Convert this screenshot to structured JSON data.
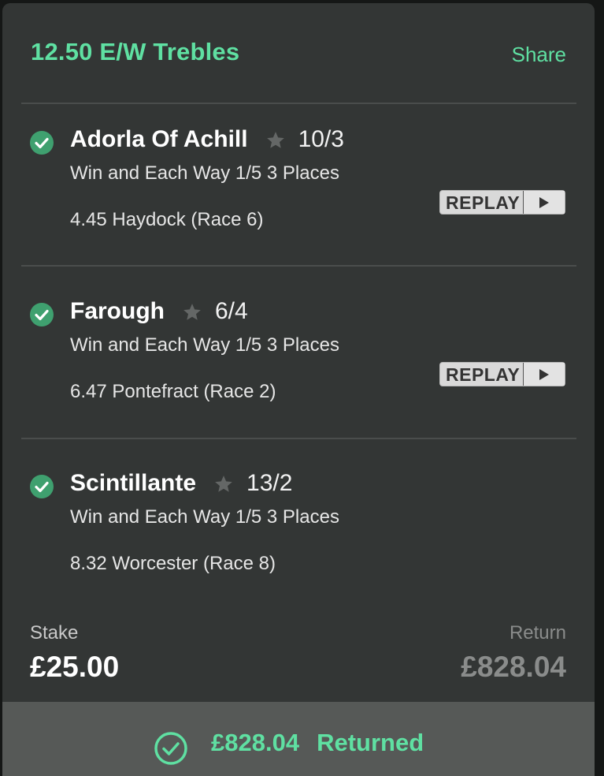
{
  "header": {
    "title": "12.50 E/W Trebles",
    "share_label": "Share"
  },
  "legs": [
    {
      "selection": "Adorla Of Achill",
      "odds": "10/3",
      "market": "Win and Each Way 1/5 3 Places",
      "race": "4.45 Haydock (Race 6)",
      "replay_label": "REPLAY",
      "status_icon": "check-circle-icon"
    },
    {
      "selection": "Farough",
      "odds": "6/4",
      "market": "Win and Each Way 1/5 3 Places",
      "race": "6.47 Pontefract (Race 2)",
      "replay_label": "REPLAY",
      "status_icon": "check-circle-icon"
    },
    {
      "selection": "Scintillante",
      "odds": "13/2",
      "market": "Win and Each Way 1/5 3 Places",
      "race": "8.32 Worcester (Race 8)",
      "status_icon": "check-circle-icon"
    }
  ],
  "summary": {
    "stake_label": "Stake",
    "stake_value": "£25.00",
    "return_label": "Return",
    "return_value": "£828.04"
  },
  "footer": {
    "amount": "£828.04",
    "status": "Returned"
  },
  "colors": {
    "accent": "#5fe0a2",
    "card": "#333635",
    "footer": "#565957",
    "check": "#3fa06f"
  }
}
